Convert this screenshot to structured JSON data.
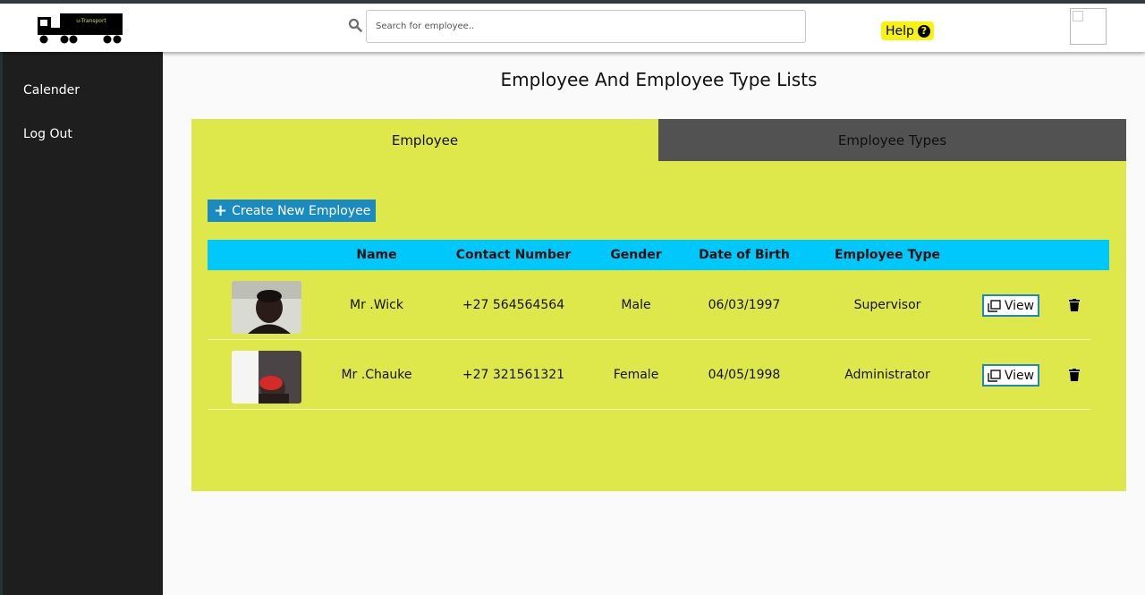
{
  "header": {
    "logo_text": "u-Transport",
    "search_placeholder": "Search for employee..",
    "help_label": "Help",
    "help_icon": "question-circle-icon"
  },
  "sidebar": {
    "items": [
      {
        "label": "Calender"
      },
      {
        "label": "Log Out"
      }
    ]
  },
  "main": {
    "title": "Employee And Employee Type Lists",
    "tabs": [
      {
        "label": "Employee",
        "active": true
      },
      {
        "label": "Employee Types",
        "active": false
      }
    ],
    "create_button_label": "Create New Employee",
    "table": {
      "columns": [
        "",
        "Name",
        "Contact Number",
        "Gender",
        "Date of Birth",
        "Employee Type",
        "",
        ""
      ],
      "rows": [
        {
          "name": "Mr .Wick",
          "contact": "+27 564564564",
          "gender": "Male",
          "dob": "06/03/1997",
          "type": "Supervisor",
          "view_label": "View"
        },
        {
          "name": "Mr .Chauke",
          "contact": "+27 321561321",
          "gender": "Female",
          "dob": "04/05/1998",
          "type": "Administrator",
          "view_label": "View"
        }
      ]
    }
  },
  "colors": {
    "panel": "#dee84a",
    "table_header": "#00c8fa",
    "accent_blue": "#1a8bc0",
    "help_yellow": "#f7f30f",
    "sidebar": "#1e1e1e",
    "inactive_tab": "#525252"
  }
}
